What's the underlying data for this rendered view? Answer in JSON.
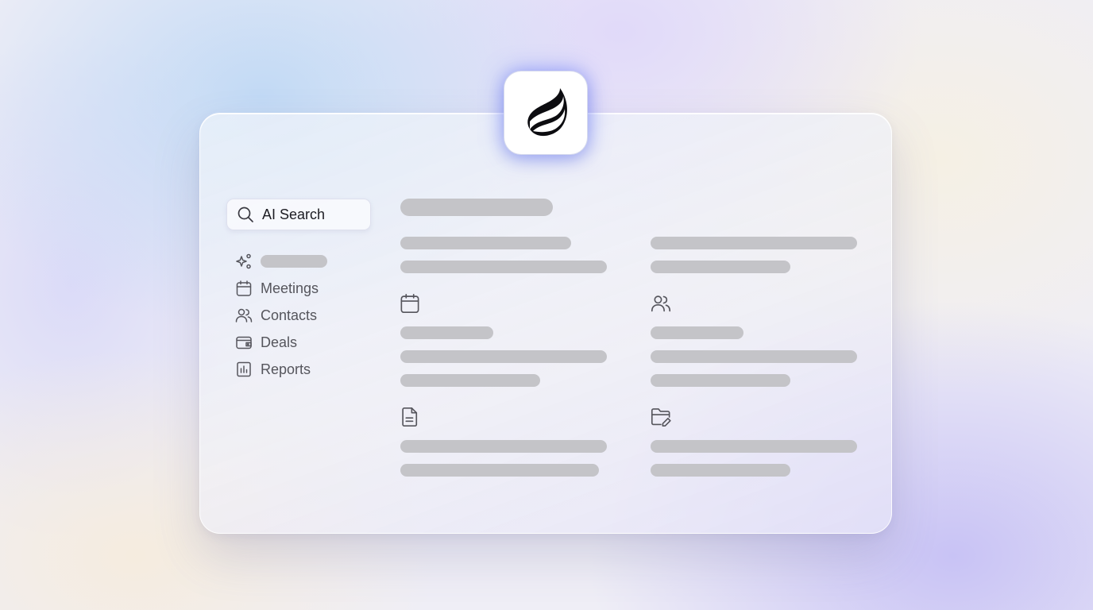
{
  "app": {
    "logo_icon": "flame-icon"
  },
  "search": {
    "icon": "search-icon",
    "label": "AI Search"
  },
  "sidebar": {
    "items": [
      {
        "icon": "sparkles-icon",
        "label": ""
      },
      {
        "icon": "calendar-icon",
        "label": "Meetings"
      },
      {
        "icon": "users-icon",
        "label": "Contacts"
      },
      {
        "icon": "wallet-icon",
        "label": "Deals"
      },
      {
        "icon": "bar-chart-icon",
        "label": "Reports"
      }
    ]
  },
  "content": {
    "section_icons": [
      "calendar-icon",
      "users-icon",
      "document-icon",
      "folder-edit-icon"
    ]
  },
  "colors": {
    "skeleton": "#c4c4c8",
    "icon_stroke": "#55555c",
    "logo_glow": "#5a6eff"
  }
}
